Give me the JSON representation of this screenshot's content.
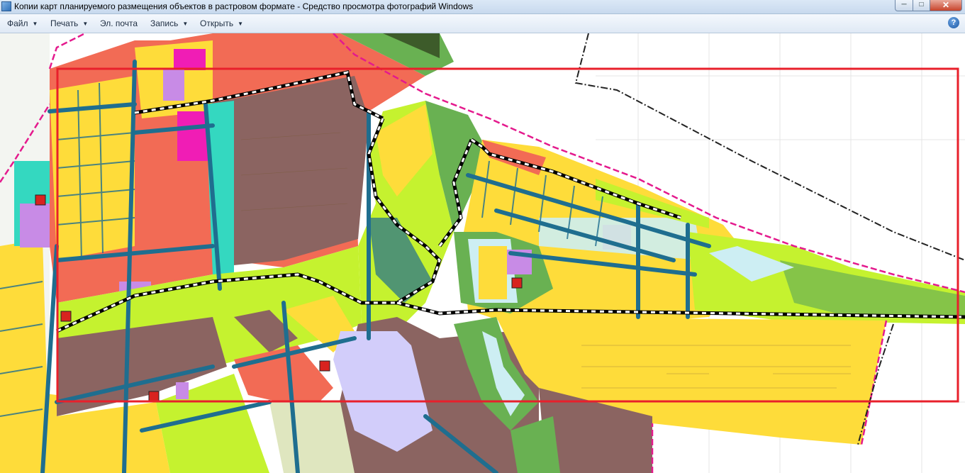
{
  "window": {
    "title": "Копии карт планируемого размещения объектов в растровом формате - Средство просмотра фотографий Windows",
    "minimize_glyph": "─",
    "maximize_glyph": "□",
    "close_glyph": "✕"
  },
  "menu": {
    "file": "Файл",
    "print": "Печать",
    "email": "Эл. почта",
    "burn": "Запись",
    "open": "Открыть",
    "help_glyph": "?"
  },
  "icons": [
    "photo-viewer-app-icon",
    "caret-down-icon",
    "help-icon"
  ],
  "colors": {
    "industrial": "#8b6461",
    "public": "#f26b55",
    "residential_low": "#fedc3a",
    "green": "#c5f22f",
    "park": "#69b152",
    "road": "#1f6e8f",
    "water": "#cdeef3",
    "social": "#c88be6",
    "commercial": "#f01db5",
    "boundary": "#e41a8d",
    "selection_frame": "#e8202b"
  }
}
